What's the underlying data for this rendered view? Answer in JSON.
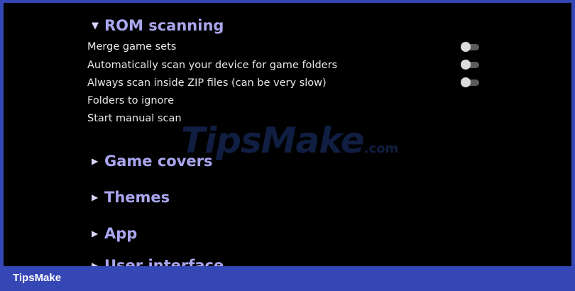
{
  "sections": {
    "rom_scanning": {
      "label": "ROM scanning",
      "arrow": "▼"
    },
    "game_covers": {
      "label": "Game covers",
      "arrow": "▶"
    },
    "themes": {
      "label": "Themes",
      "arrow": "▶"
    },
    "app": {
      "label": "App",
      "arrow": "▶"
    },
    "user_interface": {
      "label": "User interface",
      "arrow": "▶"
    }
  },
  "rom_scanning_items": {
    "merge_game_sets": {
      "label": "Merge game sets",
      "toggle": "off"
    },
    "auto_scan": {
      "label": "Automatically scan your device for game folders",
      "toggle": "off"
    },
    "scan_zip": {
      "label": "Always scan inside ZIP files (can be very slow)",
      "toggle": "off"
    },
    "folders_ignore": {
      "label": "Folders to ignore"
    },
    "manual_scan": {
      "label": "Start manual scan"
    }
  },
  "watermark": {
    "main": "TipsMake",
    "suffix": ".com"
  },
  "footer": {
    "brand": "TipsMake"
  },
  "colors": {
    "background": "#000000",
    "section_header": "#a9a6ee",
    "frame": "#3547b4"
  }
}
